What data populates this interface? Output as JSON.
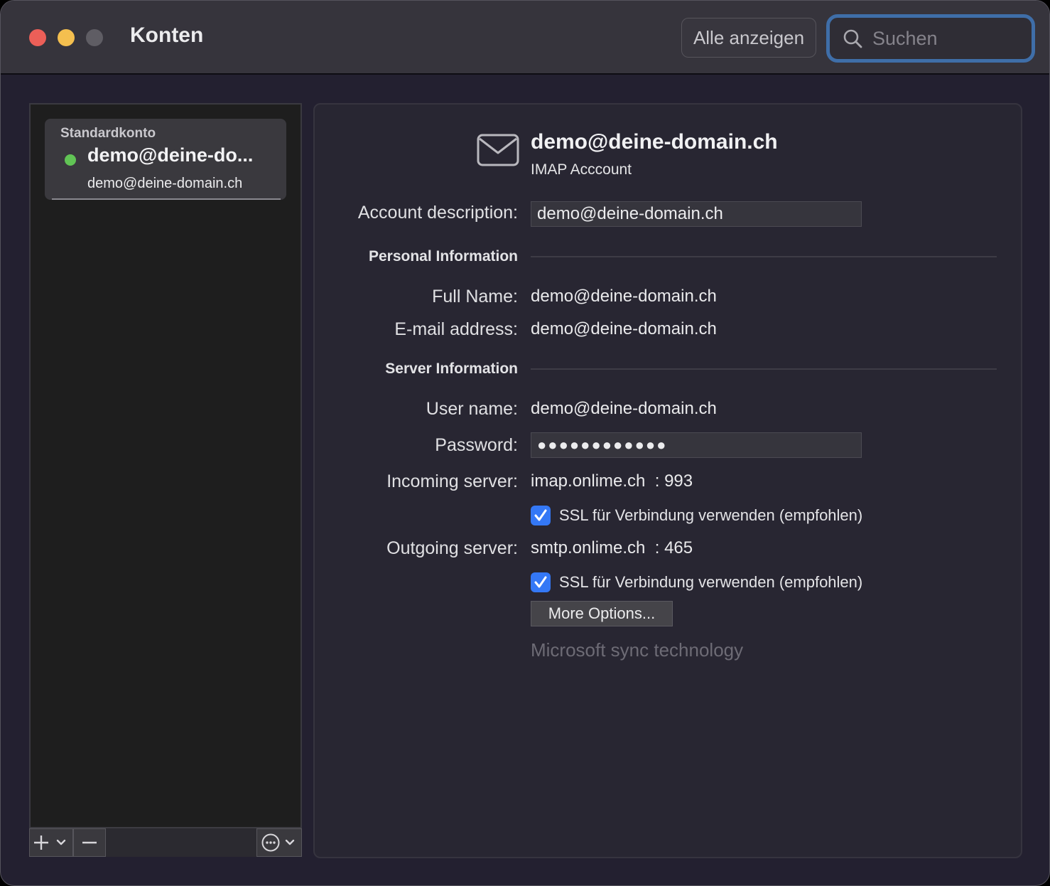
{
  "window": {
    "title": "Konten"
  },
  "toolbar": {
    "show_all_label": "Alle anzeigen",
    "search_placeholder": "Suchen",
    "search_icon": "search-icon"
  },
  "sidebar": {
    "account": {
      "header": "Standardkonto",
      "name": "demo@deine-do...",
      "email": "demo@deine-domain.ch",
      "status_color": "#61c455"
    },
    "bottom_buttons": {
      "add_icon": "plus-icon",
      "remove_icon": "minus-icon",
      "more_icon": "ellipsis-circle-icon"
    }
  },
  "detail": {
    "title": "demo@deine-domain.ch",
    "subtitle": "IMAP Acccount",
    "icon": "envelope-icon",
    "account_description_label": "Account description:",
    "account_description_value": "demo@deine-domain.ch",
    "personal_section": "Personal Information",
    "full_name_label": "Full Name:",
    "full_name_value": "demo@deine-domain.ch",
    "email_label": "E-mail address:",
    "email_value": "demo@deine-domain.ch",
    "server_section": "Server Information",
    "username_label": "User name:",
    "username_value": "demo@deine-domain.ch",
    "password_label": "Password:",
    "password_value": "●●●●●●●●●●●●",
    "incoming_label": "Incoming server:",
    "incoming_value": "imap.onlime.ch  : 993",
    "incoming_ssl_label": "SSL für Verbindung verwenden (empfohlen)",
    "incoming_ssl_checked": true,
    "outgoing_label": "Outgoing server:",
    "outgoing_value": "smtp.onlime.ch  : 465",
    "outgoing_ssl_label": "SSL für Verbindung verwenden (empfohlen)",
    "outgoing_ssl_checked": true,
    "more_options_label": "More Options...",
    "sync_text": "Microsoft sync technology"
  },
  "colors": {
    "accent": "#3478f6",
    "search_focus": "#3f6ea8",
    "close": "#ec5f58",
    "minimize": "#f4bf4f"
  }
}
